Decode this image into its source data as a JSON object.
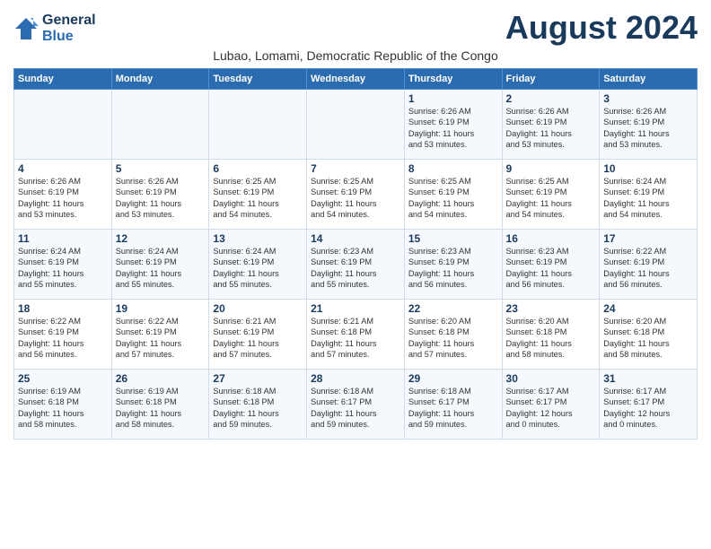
{
  "header": {
    "logo_line1": "General",
    "logo_line2": "Blue",
    "month_title": "August 2024",
    "location": "Lubao, Lomami, Democratic Republic of the Congo"
  },
  "days_of_week": [
    "Sunday",
    "Monday",
    "Tuesday",
    "Wednesday",
    "Thursday",
    "Friday",
    "Saturday"
  ],
  "weeks": [
    [
      {
        "day": "",
        "info": ""
      },
      {
        "day": "",
        "info": ""
      },
      {
        "day": "",
        "info": ""
      },
      {
        "day": "",
        "info": ""
      },
      {
        "day": "1",
        "info": "Sunrise: 6:26 AM\nSunset: 6:19 PM\nDaylight: 11 hours\nand 53 minutes."
      },
      {
        "day": "2",
        "info": "Sunrise: 6:26 AM\nSunset: 6:19 PM\nDaylight: 11 hours\nand 53 minutes."
      },
      {
        "day": "3",
        "info": "Sunrise: 6:26 AM\nSunset: 6:19 PM\nDaylight: 11 hours\nand 53 minutes."
      }
    ],
    [
      {
        "day": "4",
        "info": "Sunrise: 6:26 AM\nSunset: 6:19 PM\nDaylight: 11 hours\nand 53 minutes."
      },
      {
        "day": "5",
        "info": "Sunrise: 6:26 AM\nSunset: 6:19 PM\nDaylight: 11 hours\nand 53 minutes."
      },
      {
        "day": "6",
        "info": "Sunrise: 6:25 AM\nSunset: 6:19 PM\nDaylight: 11 hours\nand 54 minutes."
      },
      {
        "day": "7",
        "info": "Sunrise: 6:25 AM\nSunset: 6:19 PM\nDaylight: 11 hours\nand 54 minutes."
      },
      {
        "day": "8",
        "info": "Sunrise: 6:25 AM\nSunset: 6:19 PM\nDaylight: 11 hours\nand 54 minutes."
      },
      {
        "day": "9",
        "info": "Sunrise: 6:25 AM\nSunset: 6:19 PM\nDaylight: 11 hours\nand 54 minutes."
      },
      {
        "day": "10",
        "info": "Sunrise: 6:24 AM\nSunset: 6:19 PM\nDaylight: 11 hours\nand 54 minutes."
      }
    ],
    [
      {
        "day": "11",
        "info": "Sunrise: 6:24 AM\nSunset: 6:19 PM\nDaylight: 11 hours\nand 55 minutes."
      },
      {
        "day": "12",
        "info": "Sunrise: 6:24 AM\nSunset: 6:19 PM\nDaylight: 11 hours\nand 55 minutes."
      },
      {
        "day": "13",
        "info": "Sunrise: 6:24 AM\nSunset: 6:19 PM\nDaylight: 11 hours\nand 55 minutes."
      },
      {
        "day": "14",
        "info": "Sunrise: 6:23 AM\nSunset: 6:19 PM\nDaylight: 11 hours\nand 55 minutes."
      },
      {
        "day": "15",
        "info": "Sunrise: 6:23 AM\nSunset: 6:19 PM\nDaylight: 11 hours\nand 56 minutes."
      },
      {
        "day": "16",
        "info": "Sunrise: 6:23 AM\nSunset: 6:19 PM\nDaylight: 11 hours\nand 56 minutes."
      },
      {
        "day": "17",
        "info": "Sunrise: 6:22 AM\nSunset: 6:19 PM\nDaylight: 11 hours\nand 56 minutes."
      }
    ],
    [
      {
        "day": "18",
        "info": "Sunrise: 6:22 AM\nSunset: 6:19 PM\nDaylight: 11 hours\nand 56 minutes."
      },
      {
        "day": "19",
        "info": "Sunrise: 6:22 AM\nSunset: 6:19 PM\nDaylight: 11 hours\nand 57 minutes."
      },
      {
        "day": "20",
        "info": "Sunrise: 6:21 AM\nSunset: 6:19 PM\nDaylight: 11 hours\nand 57 minutes."
      },
      {
        "day": "21",
        "info": "Sunrise: 6:21 AM\nSunset: 6:18 PM\nDaylight: 11 hours\nand 57 minutes."
      },
      {
        "day": "22",
        "info": "Sunrise: 6:20 AM\nSunset: 6:18 PM\nDaylight: 11 hours\nand 57 minutes."
      },
      {
        "day": "23",
        "info": "Sunrise: 6:20 AM\nSunset: 6:18 PM\nDaylight: 11 hours\nand 58 minutes."
      },
      {
        "day": "24",
        "info": "Sunrise: 6:20 AM\nSunset: 6:18 PM\nDaylight: 11 hours\nand 58 minutes."
      }
    ],
    [
      {
        "day": "25",
        "info": "Sunrise: 6:19 AM\nSunset: 6:18 PM\nDaylight: 11 hours\nand 58 minutes."
      },
      {
        "day": "26",
        "info": "Sunrise: 6:19 AM\nSunset: 6:18 PM\nDaylight: 11 hours\nand 58 minutes."
      },
      {
        "day": "27",
        "info": "Sunrise: 6:18 AM\nSunset: 6:18 PM\nDaylight: 11 hours\nand 59 minutes."
      },
      {
        "day": "28",
        "info": "Sunrise: 6:18 AM\nSunset: 6:17 PM\nDaylight: 11 hours\nand 59 minutes."
      },
      {
        "day": "29",
        "info": "Sunrise: 6:18 AM\nSunset: 6:17 PM\nDaylight: 11 hours\nand 59 minutes."
      },
      {
        "day": "30",
        "info": "Sunrise: 6:17 AM\nSunset: 6:17 PM\nDaylight: 12 hours\nand 0 minutes."
      },
      {
        "day": "31",
        "info": "Sunrise: 6:17 AM\nSunset: 6:17 PM\nDaylight: 12 hours\nand 0 minutes."
      }
    ]
  ]
}
